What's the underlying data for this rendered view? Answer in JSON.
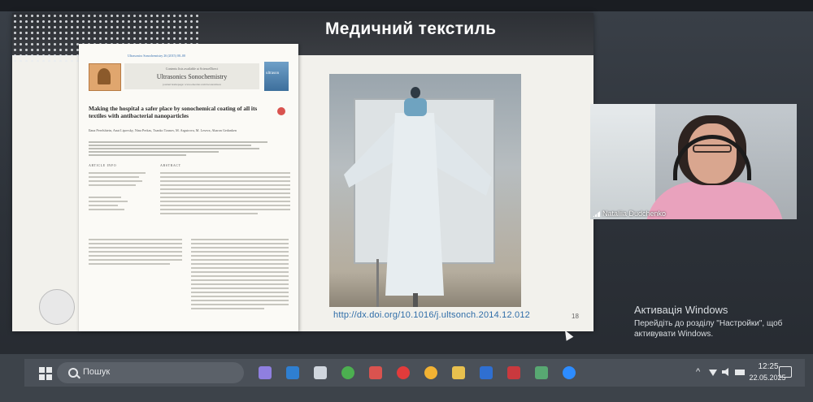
{
  "slide": {
    "title": "Медичний текстиль",
    "doi": "http://dx.doi.org/10.1016/j.ultsonch.2014.12.012",
    "page_number": "18"
  },
  "article": {
    "journal": "Ultrasonics Sonochemistry",
    "contents_line": "Contents lists available at ScienceDirect",
    "homepage_line": "journal homepage: www.elsevier.com/locate/ultson",
    "citation_line": "Ultrasonics Sonochemistry 26 (2015) 00–00",
    "cover_label": "ultrason",
    "title": "Making the hospital a safer place by sonochemical coating of all its textiles with antibacterial nanoparticles",
    "authors": "Ilana Perelshtein, Anat Lipovsky, Nina Perkas, Tzanko Tzanov, M. Arguirova, M. Leseva, Aharon Gedanken",
    "info_header": "ARTICLE INFO",
    "abstract_header": "ABSTRACT"
  },
  "webcam": {
    "participant_name": "Nataliia Dudchenko"
  },
  "activation": {
    "title": "Активація Windows",
    "text": "Перейдіть до розділу \"Настройки\", щоб активувати Windows."
  },
  "taskbar": {
    "search_placeholder": "Пошук",
    "clock_time": "12:25",
    "clock_date": "22.05.2025",
    "apps": [
      {
        "name": "copilot",
        "color": "#8f7fe0"
      },
      {
        "name": "outlook",
        "color": "#2f7fd1"
      },
      {
        "name": "store",
        "color": "#d0d6de"
      },
      {
        "name": "chrome",
        "color": "#4caf50"
      },
      {
        "name": "powerpoint",
        "color": "#d9534f"
      },
      {
        "name": "opera",
        "color": "#e23b3b"
      },
      {
        "name": "chrome-profile",
        "color": "#f2b233"
      },
      {
        "name": "files",
        "color": "#e8c04e"
      },
      {
        "name": "word",
        "color": "#2f6fd1"
      },
      {
        "name": "downloader",
        "color": "#c9393e"
      },
      {
        "name": "image-viewer",
        "color": "#58a872"
      },
      {
        "name": "zoom",
        "color": "#2d8cff"
      }
    ]
  }
}
